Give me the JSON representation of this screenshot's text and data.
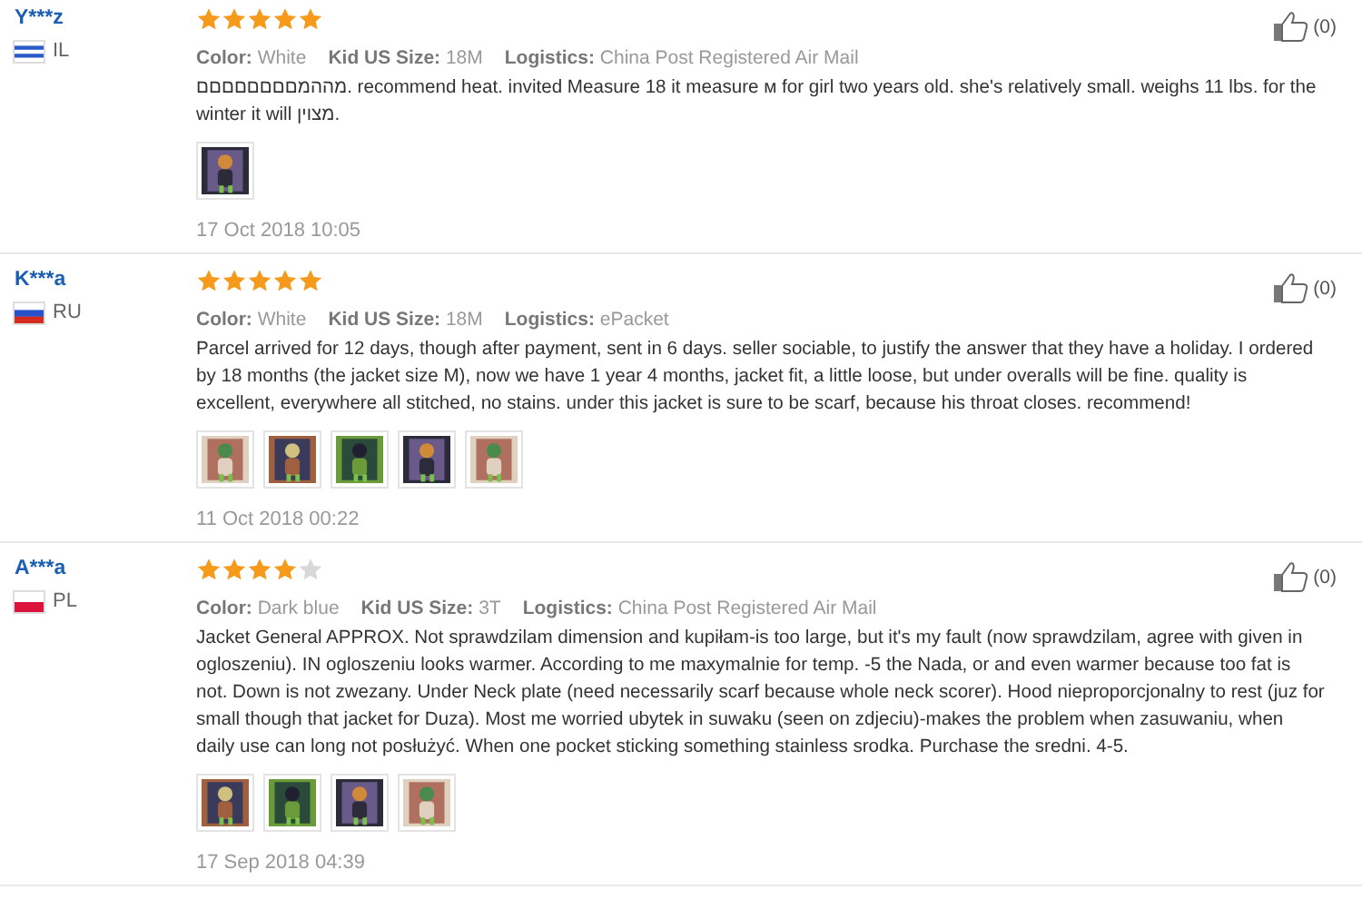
{
  "reviews": [
    {
      "name": "Y***z",
      "country": "IL",
      "flag_stripes": [
        {
          "color": "#ffffff"
        },
        {
          "color": "#2a5cc7"
        },
        {
          "color": "#ffffff"
        },
        {
          "color": "#2a5cc7"
        },
        {
          "color": "#ffffff"
        }
      ],
      "stars": 5,
      "attributes": [
        {
          "label": "Color:",
          "value": "White"
        },
        {
          "label": "Kid US Size:",
          "value": "18M"
        },
        {
          "label": "Logistics:",
          "value": "China Post Registered Air Mail"
        }
      ],
      "text": "מההמםםםםםםםם. recommend heat. invited Measure 18 it measure м for girl two years old. she's relatively small. weighs 11 lbs. for the winter it will מצוין.",
      "photos": [
        {
          "kind": "picture"
        }
      ],
      "date": "17 Oct 2018 10:05",
      "likes": "(0)"
    },
    {
      "name": "K***a",
      "country": "RU",
      "flag_stripes": [
        {
          "color": "#ffffff"
        },
        {
          "color": "#2850c8"
        },
        {
          "color": "#d52b1e"
        }
      ],
      "stars": 5,
      "attributes": [
        {
          "label": "Color:",
          "value": "White"
        },
        {
          "label": "Kid US Size:",
          "value": "18M"
        },
        {
          "label": "Logistics:",
          "value": "ePacket"
        }
      ],
      "text": "Parcel arrived for 12 days, though after payment, sent in 6 days. seller sociable, to justify the answer that they have a holiday. I ordered by 18 months (the jacket size M), now we have 1 year 4 months, jacket fit, a little loose, but under overalls will be fine. quality is excellent, everywhere all stitched, no stains. under this jacket is sure to be scarf, because his throat closes. recommend!",
      "photos": [
        {
          "kind": "picture"
        },
        {
          "kind": "picture"
        },
        {
          "kind": "picture"
        },
        {
          "kind": "picture"
        },
        {
          "kind": "picture"
        }
      ],
      "date": "11 Oct 2018 00:22",
      "likes": "(0)"
    },
    {
      "name": "A***a",
      "country": "PL",
      "flag_stripes": [
        {
          "color": "#ffffff"
        },
        {
          "color": "#dc143c"
        }
      ],
      "stars": 4,
      "attributes": [
        {
          "label": "Color:",
          "value": "Dark blue"
        },
        {
          "label": "Kid US Size:",
          "value": "3T"
        },
        {
          "label": "Logistics:",
          "value": "China Post Registered Air Mail"
        }
      ],
      "text": "Jacket General APPROX. Not sprawdzilam dimension and kupiłam-is too large, but it's my fault (now sprawdzilam, agree with given in ogloszeniu). IN ogloszeniu looks warmer. According to me maxymalnie for temp. -5 the Nada, or and even warmer because too fat is not. Down is not zwezany. Under Neck plate (need necessarily scarf because whole neck scorer). Hood nieproporcjonalny to rest (juz for small though that jacket for Duza). Most me worried ubytek in suwaku (seen on zdjeciu)-makes the problem when zasuwaniu, when daily use can long not posłużyć. When one pocket sticking something stainless srodka. Purchase the sredni. 4-5.",
      "photos": [
        {
          "kind": "picture"
        },
        {
          "kind": "picture"
        },
        {
          "kind": "picture"
        },
        {
          "kind": "picture"
        }
      ],
      "date": "17 Sep 2018 04:39",
      "likes": "(0)"
    }
  ]
}
